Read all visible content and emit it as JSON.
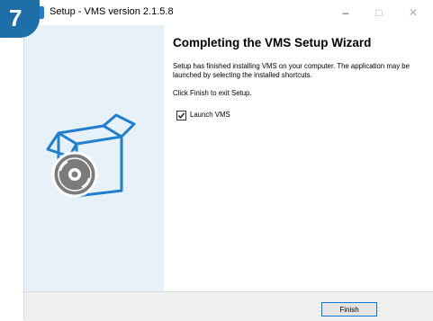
{
  "step": {
    "number": "7"
  },
  "window": {
    "title": "Setup - VMS version 2.1.5.8",
    "controls": {
      "minimize": "–",
      "maximize": "□",
      "close": "✕"
    }
  },
  "content": {
    "heading": "Completing the VMS Setup Wizard",
    "description": "Setup has finished installing VMS on your computer. The application may be launched by selecting the installed shortcuts.",
    "finish_instruction": "Click Finish to exit Setup.",
    "launch_checkbox": {
      "label": "Launch VMS",
      "checked": true
    }
  },
  "footer": {
    "finish_label": "Finish"
  },
  "colors": {
    "accent": "#1f7fd0",
    "sidebar_bg": "#e6f1fa",
    "badge": "#1e6fa8"
  },
  "icons": [
    "app-icon",
    "box-disc-icon",
    "checkmark-icon"
  ]
}
